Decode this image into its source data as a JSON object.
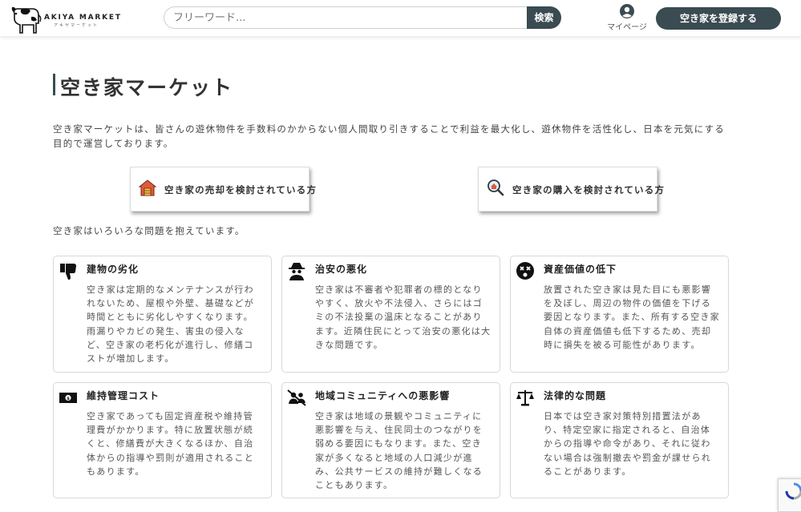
{
  "header": {
    "logo_text": "AKIYA MARKET",
    "logo_sub": "アキヤマーケット",
    "search_placeholder": "フリーワード...",
    "search_button": "検索",
    "mypage_label": "マイページ",
    "register_button": "空き家を登録する",
    "accent_color": "#3a4b52"
  },
  "main": {
    "title": "空き家マーケット",
    "intro": "空き家マーケットは、皆さんの遊休物件を手数料のかからない個人間取り引きすることで利益を最大化し、遊休物件を活性化し、日本を元気にする目的で運営しております。",
    "cta": [
      {
        "label": "空き家の売却を検討されている方",
        "icon": "house-icon"
      },
      {
        "label": "空き家の購入を検討されている方",
        "icon": "magnifier-house-icon"
      }
    ],
    "problems_intro": "空き家はいろいろな問題を抱えています。",
    "problems": [
      {
        "title": "建物の劣化",
        "icon": "thumbs-down-icon",
        "body": "空き家は定期的なメンテナンスが行われないため、屋根や外壁、基礎などが時間とともに劣化しやすくなります。雨漏りやカビの発生、害虫の侵入など、空き家の老朽化が進行し、修繕コストが増加します。"
      },
      {
        "title": "治安の悪化",
        "icon": "spy-icon",
        "body": "空き家は不審者や犯罪者の標的となりやすく、放火や不法侵入、さらにはゴミの不法投棄の温床となることがあります。近隣住民にとって治安の悪化は大きな問題です。"
      },
      {
        "title": "資産価値の低下",
        "icon": "dizzy-face-icon",
        "body": "放置された空き家は見た目にも悪影響を及ぼし、周辺の物件の価値を下げる要因となります。また、所有する空き家自体の資産価値も低下するため、売却時に損失を被る可能性があります。"
      },
      {
        "title": "維持管理コスト",
        "icon": "money-bill-icon",
        "body": "空き家であっても固定資産税や維持管理費がかかります。特に放置状態が続くと、修繕費が大きくなるほか、自治体からの指導や罰則が適用されることもあります。"
      },
      {
        "title": "地域コミュニティへの悪影響",
        "icon": "users-slash-icon",
        "body": "空き家は地域の景観やコミュニティに悪影響を与え、住民同士のつながりを弱める要因にもなります。また、空き家が多くなると地域の人口減少が進み、公共サービスの維持が難しくなることもあります。"
      },
      {
        "title": "法律的な問題",
        "icon": "scale-icon",
        "body": "日本では空き家対策特別措置法があり、特定空家に指定されると、自治体からの指導や命令があり、それに従わない場合は強制撤去や罰金が課せられることがあります。"
      }
    ]
  }
}
